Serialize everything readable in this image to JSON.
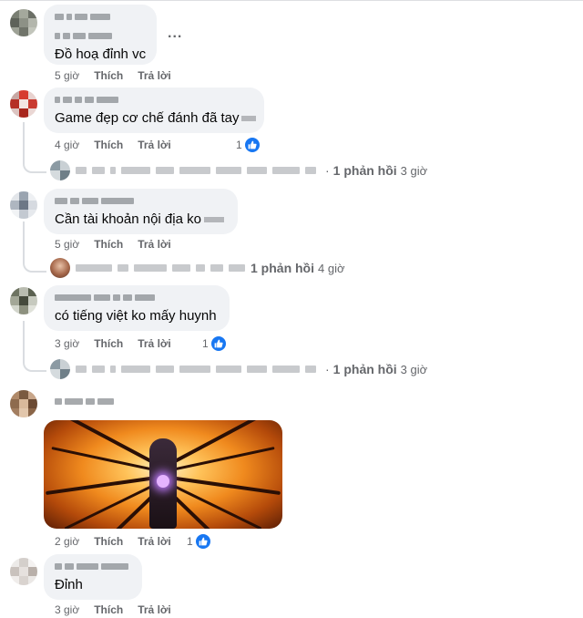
{
  "comments": [
    {
      "text": "Đồ hoạ đỉnh vc",
      "time": "5 giờ",
      "like_label": "Thích",
      "reply_label": "Trả lời",
      "more_label": "..."
    },
    {
      "text": "Game đẹp cơ chế đánh đã tay",
      "time": "4 giờ",
      "like_label": "Thích",
      "reply_label": "Trả lời",
      "reaction_count": "1",
      "replies": {
        "count_label": "1 phản hồi",
        "time": "3 giờ"
      }
    },
    {
      "text": "Cần tài khoản nội địa ko",
      "time": "5 giờ",
      "like_label": "Thích",
      "reply_label": "Trả lời",
      "replies": {
        "count_label": "1 phản hồi",
        "time": "4 giờ"
      }
    },
    {
      "text": "có tiếng việt ko mấy huynh",
      "time": "3 giờ",
      "like_label": "Thích",
      "reply_label": "Trả lời",
      "reaction_count": "1",
      "replies": {
        "count_label": "1 phản hồi",
        "time": "3 giờ"
      }
    },
    {
      "text": "",
      "time": "2 giờ",
      "like_label": "Thích",
      "reply_label": "Trả lời",
      "reaction_count": "1",
      "has_image": true
    },
    {
      "text": "Đỉnh",
      "time": "3 giờ",
      "like_label": "Thích",
      "reply_label": "Trả lời"
    }
  ],
  "colors": {
    "bubble": "#f0f2f5",
    "meta_text": "#65676b",
    "like_blue": "#1877f2",
    "thread_line": "#dadde1"
  },
  "icons": {
    "like": "thumbs-up-icon",
    "more": "more-dots-icon"
  }
}
